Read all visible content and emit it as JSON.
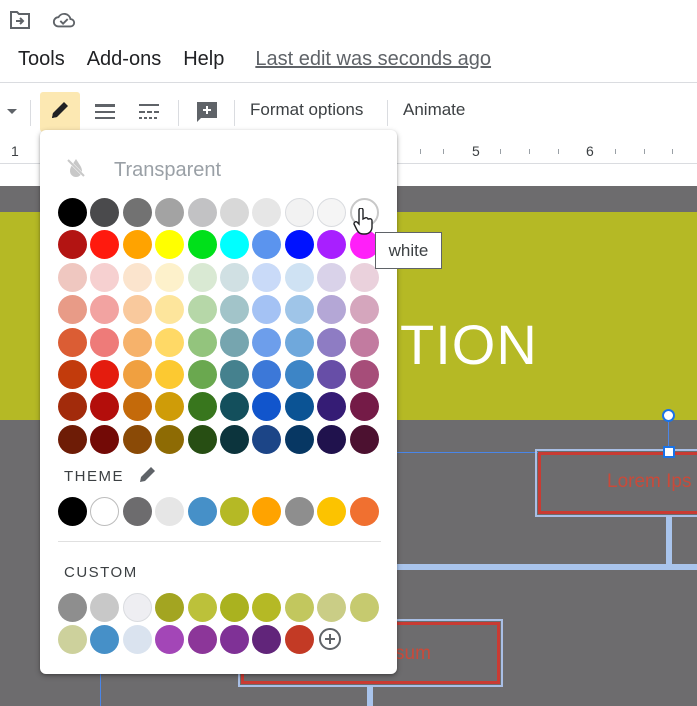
{
  "top_icons": [
    {
      "icon": "move-to-folder-icon"
    },
    {
      "icon": "cloud-saved-icon"
    }
  ],
  "menu": {
    "items": [
      "Tools",
      "Add-ons",
      "Help"
    ],
    "last_edit": "Last edit was seconds ago"
  },
  "toolbar": {
    "format_options": "Format options",
    "animate": "Animate",
    "icons": [
      "dropdown-arrow-icon",
      "pen-icon",
      "line-weight-icon",
      "line-dash-icon",
      "add-comment-icon"
    ]
  },
  "ruler": {
    "labels": [
      "1",
      "5",
      "6"
    ]
  },
  "slide": {
    "banner_text": "TION",
    "box1_text": "Lorem Ips",
    "box2_text": "sum"
  },
  "color_panel": {
    "transparent_label": "Transparent",
    "theme_label": "THEME",
    "custom_label": "CUSTOM",
    "standard_rows": [
      [
        "#000000",
        "#4a4a4c",
        "#727272",
        "#a3a3a3",
        "#c2c2c4",
        "#d8d8d8",
        "#e6e6e6",
        "#f2f2f2",
        "#f5f5f5",
        "#ffffff"
      ],
      [
        "#b31412",
        "#ff1a0e",
        "#ffa300",
        "#ffff00",
        "#00e01a",
        "#00ffff",
        "#5b94ee",
        "#0012ff",
        "#a81fff",
        "#ff1ff9"
      ],
      [
        "#efc7c0",
        "#f6d0d0",
        "#fbe4cd",
        "#fdf1cb",
        "#d9e9d3",
        "#d0e0e3",
        "#c9daf8",
        "#cfe2f3",
        "#d9d2e9",
        "#ead1dc"
      ],
      [
        "#e89b87",
        "#f2a3a1",
        "#f9c99d",
        "#fde59c",
        "#b6d7a8",
        "#a2c4c9",
        "#a4c2f4",
        "#9fc5e8",
        "#b4a7d6",
        "#d5a6bd"
      ],
      [
        "#db5d34",
        "#ee7b79",
        "#f6b26b",
        "#ffd966",
        "#93c47d",
        "#76a5af",
        "#6d9eeb",
        "#6fa8dc",
        "#8e7cc3",
        "#c27ba0"
      ],
      [
        "#c23b0c",
        "#e41c0e",
        "#f0a040",
        "#fcc931",
        "#6aa84f",
        "#45818e",
        "#3c78d8",
        "#3d85c6",
        "#674ea7",
        "#a64d79"
      ],
      [
        "#a22b0b",
        "#b30e0b",
        "#c46a0a",
        "#cf9c08",
        "#38761d",
        "#134f5c",
        "#1155cc",
        "#0b5394",
        "#351c75",
        "#741b47"
      ],
      [
        "#6e1c06",
        "#730a06",
        "#8a4a06",
        "#8e6b04",
        "#274e13",
        "#0c343d",
        "#1c4587",
        "#073763",
        "#20124d",
        "#4c1130"
      ]
    ],
    "theme_colors": [
      "#000000",
      "#ffffff",
      "#6d6c6e",
      "#e6e6e6",
      "#4690c8",
      "#b5b925",
      "#ffa300",
      "#8e8e8e",
      "#fcc300",
      "#f07030"
    ],
    "custom_row1": [
      "#8e8e8e",
      "#c8c8c8",
      "#eeeef2",
      "#a3a521",
      "#bcc13a",
      "#aab21f",
      "#b5b925",
      "#c2c75e",
      "#cacd86",
      "#c6ca6f"
    ],
    "custom_row2": [
      "#cdd19c",
      "#4690c8",
      "#dae3ef",
      "#a346b7",
      "#8c3699",
      "#7f3196",
      "#61257a",
      "#c33a25"
    ],
    "add_icon": "add-circle-icon",
    "pen_icon": "edit-pen-icon"
  },
  "tooltip": "white",
  "accent": "#1a73e8"
}
